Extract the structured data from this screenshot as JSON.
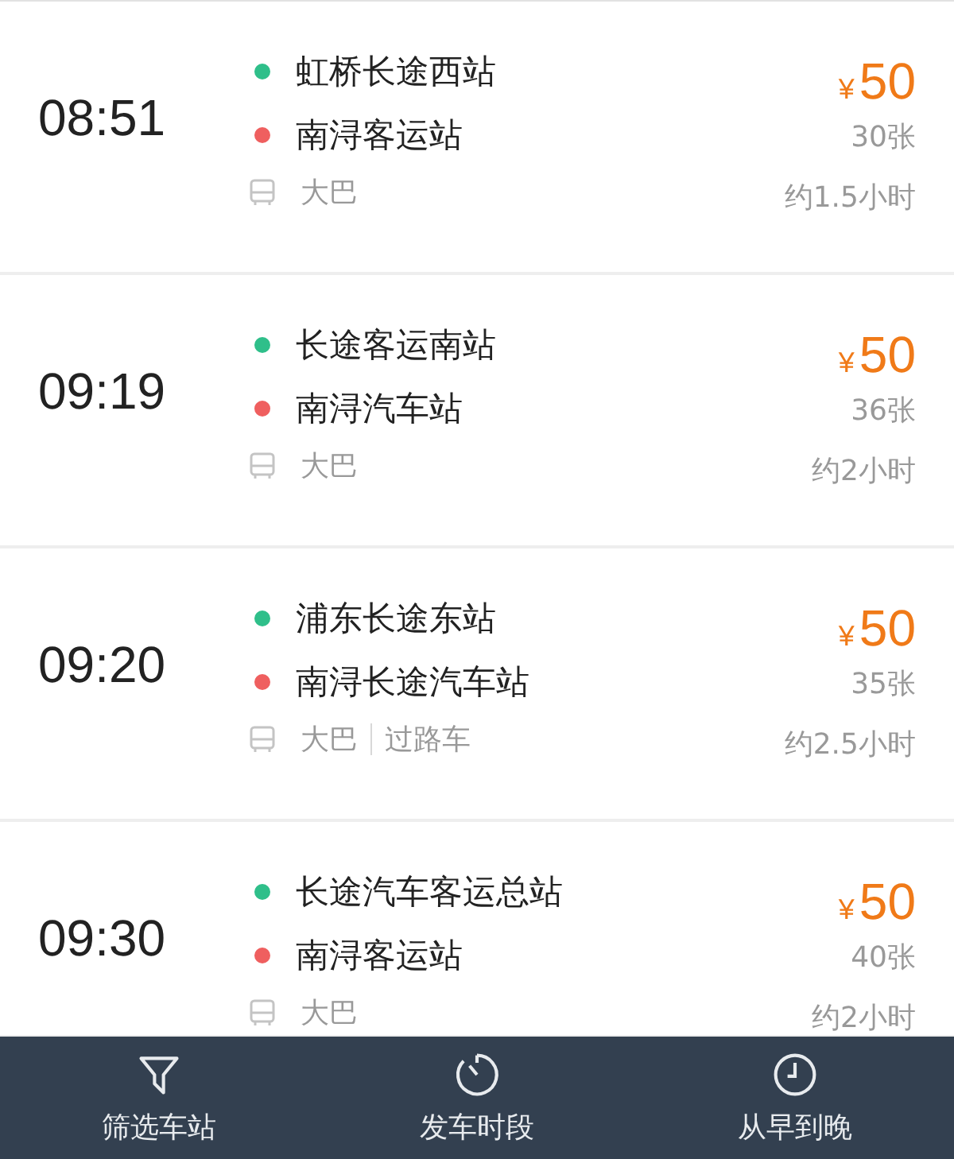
{
  "trips": [
    {
      "time": "08:51",
      "from": "虹桥长途西站",
      "to": "南浔客运站",
      "currency": "¥",
      "price": "50",
      "tickets": "30张",
      "tags": [
        "大巴"
      ],
      "duration": "约1.5小时"
    },
    {
      "time": "09:19",
      "from": "长途客运南站",
      "to": "南浔汽车站",
      "currency": "¥",
      "price": "50",
      "tickets": "36张",
      "tags": [
        "大巴"
      ],
      "duration": "约2小时"
    },
    {
      "time": "09:20",
      "from": "浦东长途东站",
      "to": "南浔长途汽车站",
      "currency": "¥",
      "price": "50",
      "tickets": "35张",
      "tags": [
        "大巴",
        "过路车"
      ],
      "duration": "约2.5小时"
    },
    {
      "time": "09:30",
      "from": "长途汽车客运总站",
      "to": "南浔客运站",
      "currency": "¥",
      "price": "50",
      "tickets": "40张",
      "tags": [
        "大巴"
      ],
      "duration": "约2小时"
    }
  ],
  "bottom_bar": [
    {
      "kind": "filter",
      "label": "筛选车站"
    },
    {
      "kind": "timer",
      "label": "发车时段"
    },
    {
      "kind": "clock",
      "label": "从早到晚"
    }
  ]
}
